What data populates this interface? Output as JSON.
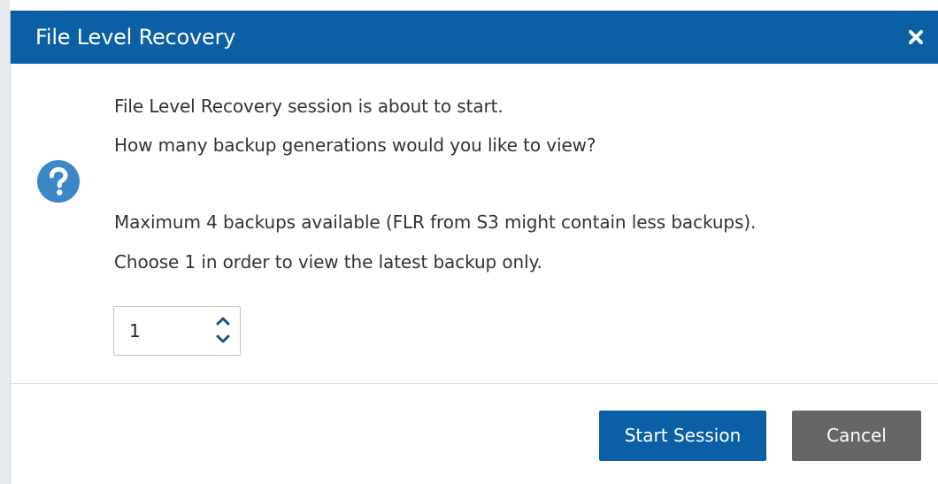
{
  "dialog": {
    "title": "File Level Recovery",
    "close_icon": "close-icon",
    "question_icon": "question-icon",
    "messages": [
      "File Level Recovery session is about to start.",
      "How many backup generations would you like to view?",
      "Maximum 4 backups available (FLR from S3 might contain less backups).",
      "Choose 1 in order to view the latest backup only."
    ],
    "generations": {
      "value": "1",
      "up_icon": "chevron-up-icon",
      "down_icon": "chevron-down-icon"
    },
    "buttons": {
      "start": "Start Session",
      "cancel": "Cancel"
    }
  },
  "colors": {
    "title_bar": "#0b5fa5",
    "primary_button": "#0b5fa5",
    "cancel_button": "#666666",
    "question_icon": "#3b87c8",
    "text": "#333333"
  }
}
